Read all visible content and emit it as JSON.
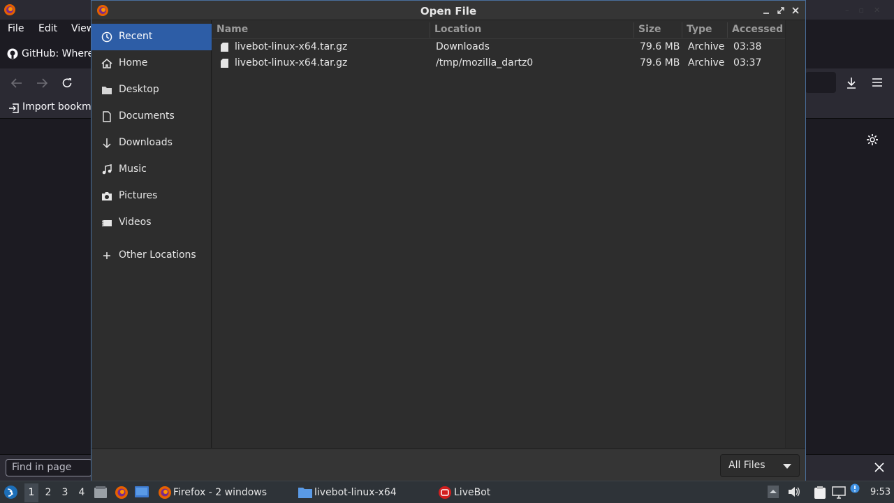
{
  "firefox": {
    "menu": [
      "File",
      "Edit",
      "View"
    ],
    "tab_title": "GitHub: Where",
    "bookmark_item": "Import bookma",
    "find_placeholder": "Find in page"
  },
  "dialog": {
    "title": "Open File",
    "sidebar": [
      {
        "label": "Recent",
        "icon": "clock-icon",
        "active": true
      },
      {
        "label": "Home",
        "icon": "home-icon"
      },
      {
        "label": "Desktop",
        "icon": "folder-icon"
      },
      {
        "label": "Documents",
        "icon": "document-icon"
      },
      {
        "label": "Downloads",
        "icon": "download-arrow-icon"
      },
      {
        "label": "Music",
        "icon": "music-icon"
      },
      {
        "label": "Pictures",
        "icon": "camera-icon"
      },
      {
        "label": "Videos",
        "icon": "video-icon"
      },
      {
        "label": "Other Locations",
        "icon": "plus-icon"
      }
    ],
    "columns": {
      "name": "Name",
      "location": "Location",
      "size": "Size",
      "type": "Type",
      "accessed": "Accessed"
    },
    "files": [
      {
        "name": "livebot-linux-x64.tar.gz",
        "location": "Downloads",
        "size": "79.6 MB",
        "type": "Archive",
        "accessed": "03:38"
      },
      {
        "name": "livebot-linux-x64.tar.gz",
        "location": "/tmp/mozilla_dartz0",
        "size": "79.6 MB",
        "type": "Archive",
        "accessed": "03:37"
      }
    ],
    "filter": "All Files"
  },
  "taskbar": {
    "workspaces": [
      "1",
      "2",
      "3",
      "4"
    ],
    "active_workspace": "1",
    "tasks": [
      {
        "label": "Firefox - 2 windows",
        "icon": "firefox-icon"
      },
      {
        "label": "livebot-linux-x64",
        "icon": "folder-icon"
      },
      {
        "label": "LiveBot",
        "icon": "livebot-icon"
      }
    ],
    "clock": "9:53"
  },
  "colors": {
    "accent": "#2d5da6",
    "dialog_bg": "#2d2d2d",
    "border": "#4a6f9c"
  }
}
